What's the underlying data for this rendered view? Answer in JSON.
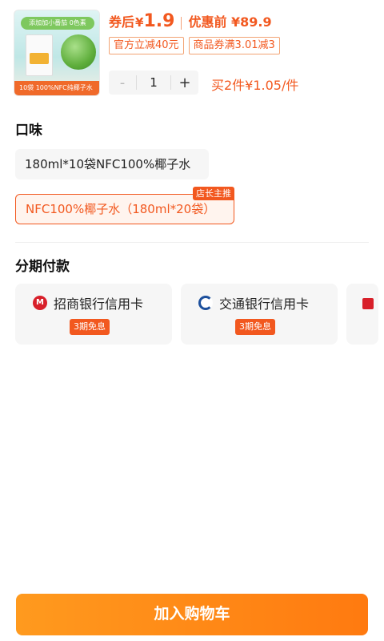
{
  "product": {
    "thumb_banner": "添加加小番茄 0色素",
    "thumb_footer": "10袋 100%NFC纯椰子水",
    "price_prefix": "券后",
    "currency": "¥",
    "price_after_coupon": "1.9",
    "orig_label": "优惠前 ¥89.9",
    "coupons": [
      "官方立减40元",
      "商品券满3.01减3"
    ],
    "quantity": "1",
    "stepper_minus": "-",
    "stepper_plus": "+",
    "multi_buy": "买2件¥1.05/件"
  },
  "flavor": {
    "title": "口味",
    "options": [
      {
        "label": "180ml*10袋NFC100%椰子水",
        "selected": false
      },
      {
        "label": "NFC100%椰子水（180ml*20袋）",
        "selected": true,
        "badge": "店长主推"
      }
    ]
  },
  "installment": {
    "title": "分期付款",
    "banks": [
      {
        "name": "招商银行信用卡",
        "badge": "3期免息",
        "icon": "cmb-bank-icon"
      },
      {
        "name": "交通银行信用卡",
        "badge": "3期免息",
        "icon": "bocom-bank-icon"
      }
    ]
  },
  "actions": {
    "add_to_cart": "加入购物车"
  },
  "colors": {
    "accent": "#f2581f",
    "button": "#ff8a16"
  }
}
